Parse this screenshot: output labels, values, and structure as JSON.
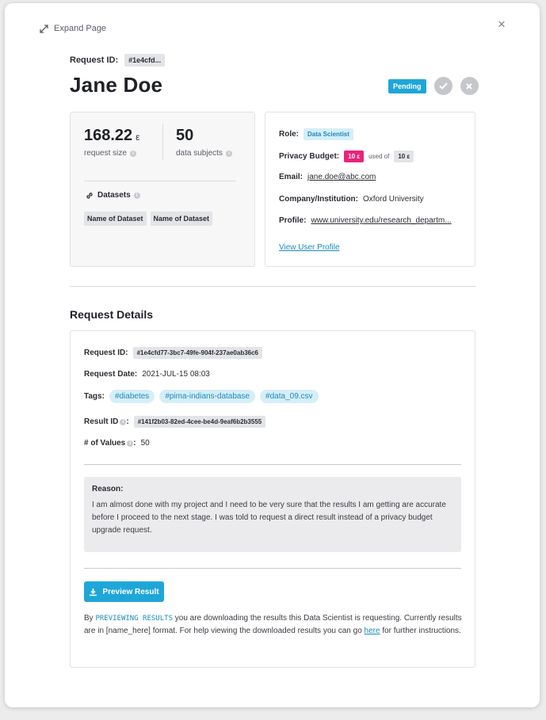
{
  "header": {
    "expand_label": "Expand Page",
    "close_glyph": "×",
    "request_id_label": "Request ID:",
    "request_id_short": "#1e4cfd...",
    "user_name": "Jane Doe",
    "status": "Pending"
  },
  "metrics": {
    "request_size_value": "168.22",
    "request_size_unit": "ε",
    "request_size_label": "request size",
    "data_subjects_value": "50",
    "data_subjects_label": "data subjects",
    "datasets_heading": "Datasets",
    "datasets": [
      "Name of Dataset",
      "Name of Dataset"
    ]
  },
  "profile": {
    "role_label": "Role:",
    "role_value": "Data Scientist",
    "budget_label": "Privacy Budget:",
    "budget_used": "10 ε",
    "budget_used_of": "used of",
    "budget_total": "10 ε",
    "email_label": "Email:",
    "email_value": "jane.doe@abc.com",
    "company_label": "Company/Institution:",
    "company_value": "Oxford University",
    "profile_label": "Profile:",
    "profile_value": "www.university.edu/research_departm...",
    "view_profile": "View User Profile"
  },
  "details": {
    "section_title": "Request Details",
    "request_id_label": "Request ID:",
    "request_id_full": "#1e4cfd77-3bc7-49fe-904f-237ae0ab36c6",
    "request_date_label": "Request Date:",
    "request_date_value": "2021-JUL-15 08:03",
    "tags_label": "Tags:",
    "tags": [
      "#diabetes",
      "#pima-indians-database",
      "#data_09.csv"
    ],
    "result_id_label": "Result ID",
    "result_id_value": "#141f2b03-82ed-4cee-be4d-9eaf6b2b3555",
    "values_label": "# of Values",
    "values_value": "50",
    "colon": ":",
    "reason_heading": "Reason:",
    "reason_text": "I am almost done with my project and I need to be very sure that the results I am getting are accurate before I proceed to the next stage. I was told to request a direct result instead of a privacy budget upgrade request.",
    "preview_button": "Preview Result",
    "footer_pre": "By ",
    "footer_mono": "PREVIEWING RESULTS",
    "footer_mid": " you are downloading the results this Data Scientist is requesting. Currently results are in [name_here] format. For help viewing the downloaded results you can go ",
    "footer_link": "here",
    "footer_post": " for further instructions."
  },
  "icons": [
    "expand-icon",
    "close-icon",
    "check-icon",
    "reject-icon",
    "info-icon",
    "link-icon",
    "download-icon"
  ],
  "colors": {
    "accent": "#1fa6d9",
    "budget": "#e8247a",
    "chip_bg": "#e3e4e7",
    "tag_bg": "#d6eef8"
  }
}
